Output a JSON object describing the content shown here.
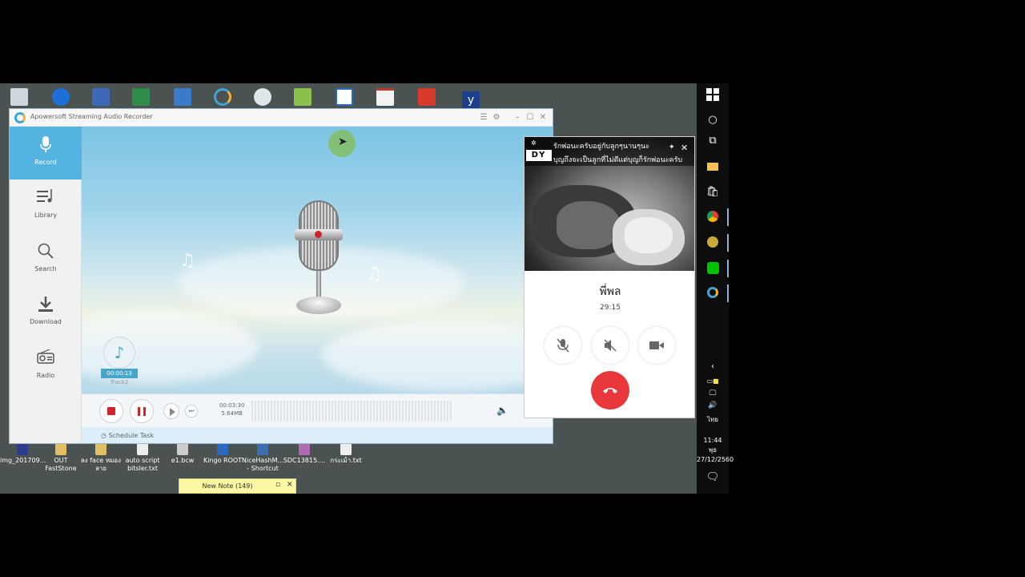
{
  "desktop": {
    "top_icons": [
      "",
      "",
      "",
      "",
      "",
      "",
      "",
      "",
      "",
      "",
      "",
      ""
    ],
    "bottom_icons": [
      {
        "label": "img_201709...",
        "color": "#2b3c8c"
      },
      {
        "label": "OUT FastStone",
        "color": "#e0c060"
      },
      {
        "label": "ลง face หมองลาย",
        "color": "#e0c060"
      },
      {
        "label": "auto script bitsler.txt",
        "color": "#eeeeee"
      },
      {
        "label": "e1.bcw",
        "color": "#cccccc"
      },
      {
        "label": "Kingo ROOT",
        "color": "#2b6ac0"
      },
      {
        "label": "NiceHashM... - Shortcut",
        "color": "#3b6fb0"
      },
      {
        "label": "SDC13815....",
        "color": "#b06ab0"
      },
      {
        "label": "กระเม้า.txt",
        "color": "#eeeeee"
      }
    ]
  },
  "app": {
    "title": "Apowersoft Streaming Audio Recorder",
    "nav": [
      {
        "label": "Record",
        "icon": "🎙"
      },
      {
        "label": "Library",
        "icon": "☰"
      },
      {
        "label": "Search",
        "icon": "⌕"
      },
      {
        "label": "Download",
        "icon": "⤓"
      },
      {
        "label": "Radio",
        "icon": "📻"
      }
    ],
    "track": {
      "time": "00:00:13",
      "name": "Track2"
    },
    "recording": {
      "duration": "00:03:30",
      "size": "5.64MB"
    },
    "schedule_label": "Schedule Task"
  },
  "call": {
    "banner_line1": "รักพ่อนะครับอยู่กับลูกๆนานๆนะ",
    "banner_line2": "บุญถึงจะเป็นลูกที่ไม่ดีแต่บุญก็รักพ่อนะครับ",
    "logo_text": "DY",
    "caller_name": "พี่พล",
    "duration": "29:15"
  },
  "taskbar": {
    "time": "11:44",
    "day": "พุธ",
    "date": "27/12/2560",
    "lang": "ไทย"
  },
  "sticky_note": {
    "label": "New Note (149)"
  }
}
